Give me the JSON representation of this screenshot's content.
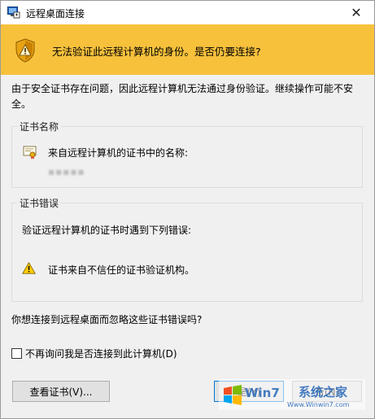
{
  "window": {
    "title": "远程桌面连接",
    "close_glyph": "✕"
  },
  "banner": {
    "message": "无法验证此远程计算机的身份。是否仍要连接?",
    "color": "#f7c13c"
  },
  "description": "由于安全证书存在问题，因此远程计算机无法通过身份验证。继续操作可能不安全。",
  "cert_name_group": {
    "title": "证书名称",
    "label": "来自远程计算机的证书中的名称:",
    "value": "▪▪▪▪▪"
  },
  "cert_error_group": {
    "title": "证书错误",
    "intro": "验证远程计算机的证书时遇到下列错误:",
    "error_item": "证书来自不信任的证书验证机构。"
  },
  "question": "你想连接到远程桌面而忽略这些证书错误吗?",
  "checkbox": {
    "label": "不再询问我是否连接到此计算机(D)",
    "checked": false
  },
  "buttons": {
    "view_cert": "查看证书(V)...",
    "yes": "是(Y)",
    "no": "否(N)"
  },
  "watermark": {
    "brand": "Win7",
    "site_cn": "系统之家",
    "url": "Www.Winwin7.com"
  }
}
